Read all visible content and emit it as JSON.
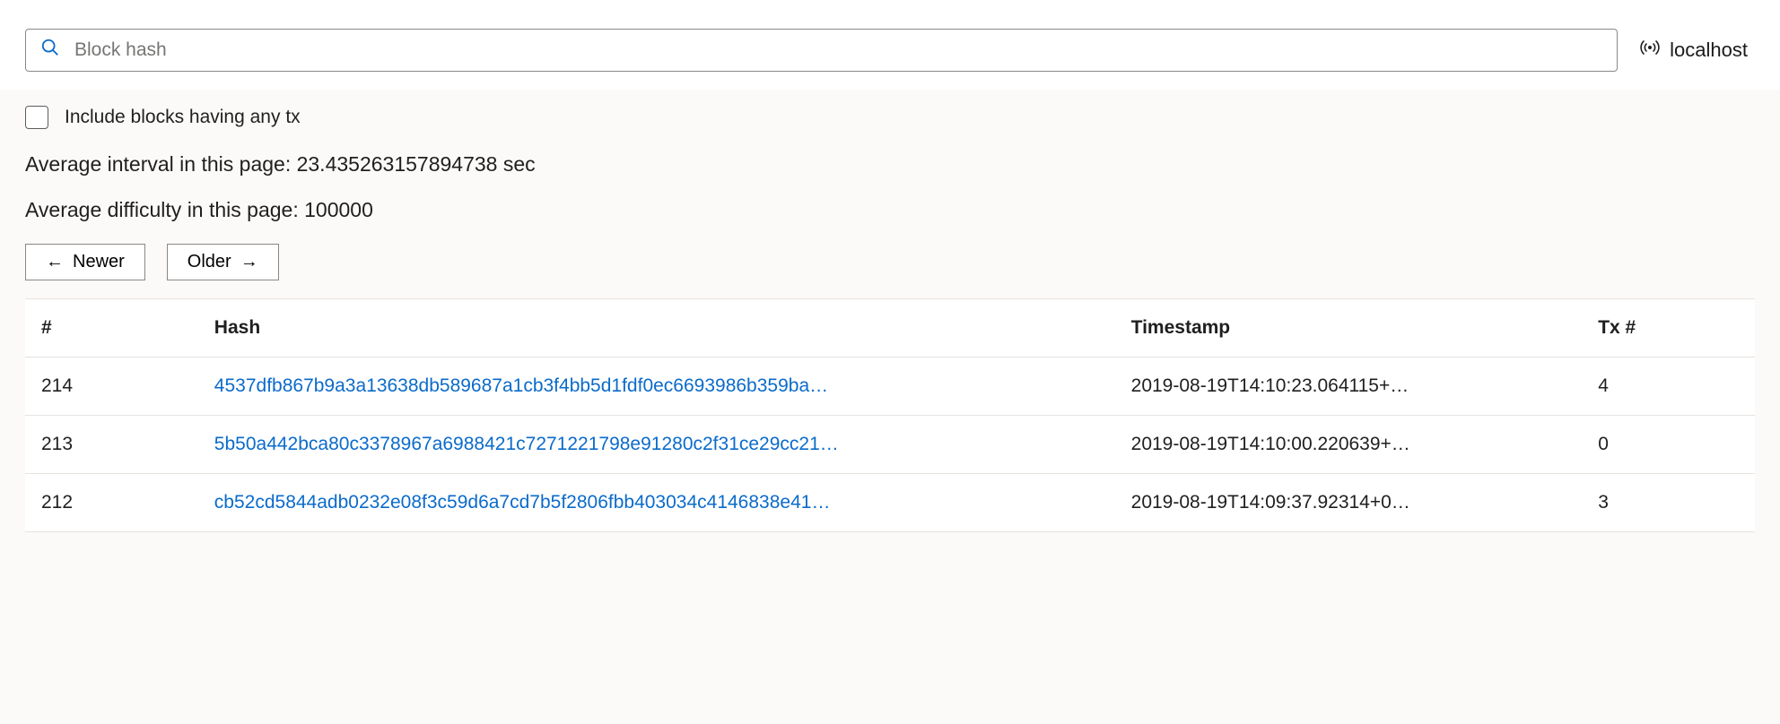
{
  "search": {
    "placeholder": "Block hash"
  },
  "endpoint": {
    "label": "localhost"
  },
  "filter": {
    "include_any_tx_label": "Include blocks having any tx"
  },
  "stats": {
    "avg_interval_line": "Average interval in this page: 23.435263157894738 sec",
    "avg_difficulty_line": "Average difficulty in this page: 100000"
  },
  "pager": {
    "newer_label": "Newer",
    "older_label": "Older"
  },
  "table": {
    "headers": {
      "index": "#",
      "hash": "Hash",
      "timestamp": "Timestamp",
      "tx": "Tx #"
    },
    "rows": [
      {
        "index": "214",
        "hash": "4537dfb867b9a3a13638db589687a1cb3f4bb5d1fdf0ec6693986b359ba…",
        "timestamp": "2019-08-19T14:10:23.064115+…",
        "tx": "4"
      },
      {
        "index": "213",
        "hash": "5b50a442bca80c3378967a6988421c7271221798e91280c2f31ce29cc21…",
        "timestamp": "2019-08-19T14:10:00.220639+…",
        "tx": "0"
      },
      {
        "index": "212",
        "hash": "cb52cd5844adb0232e08f3c59d6a7cd7b5f2806fbb403034c4146838e41…",
        "timestamp": "2019-08-19T14:09:37.92314+0…",
        "tx": "3"
      }
    ]
  }
}
